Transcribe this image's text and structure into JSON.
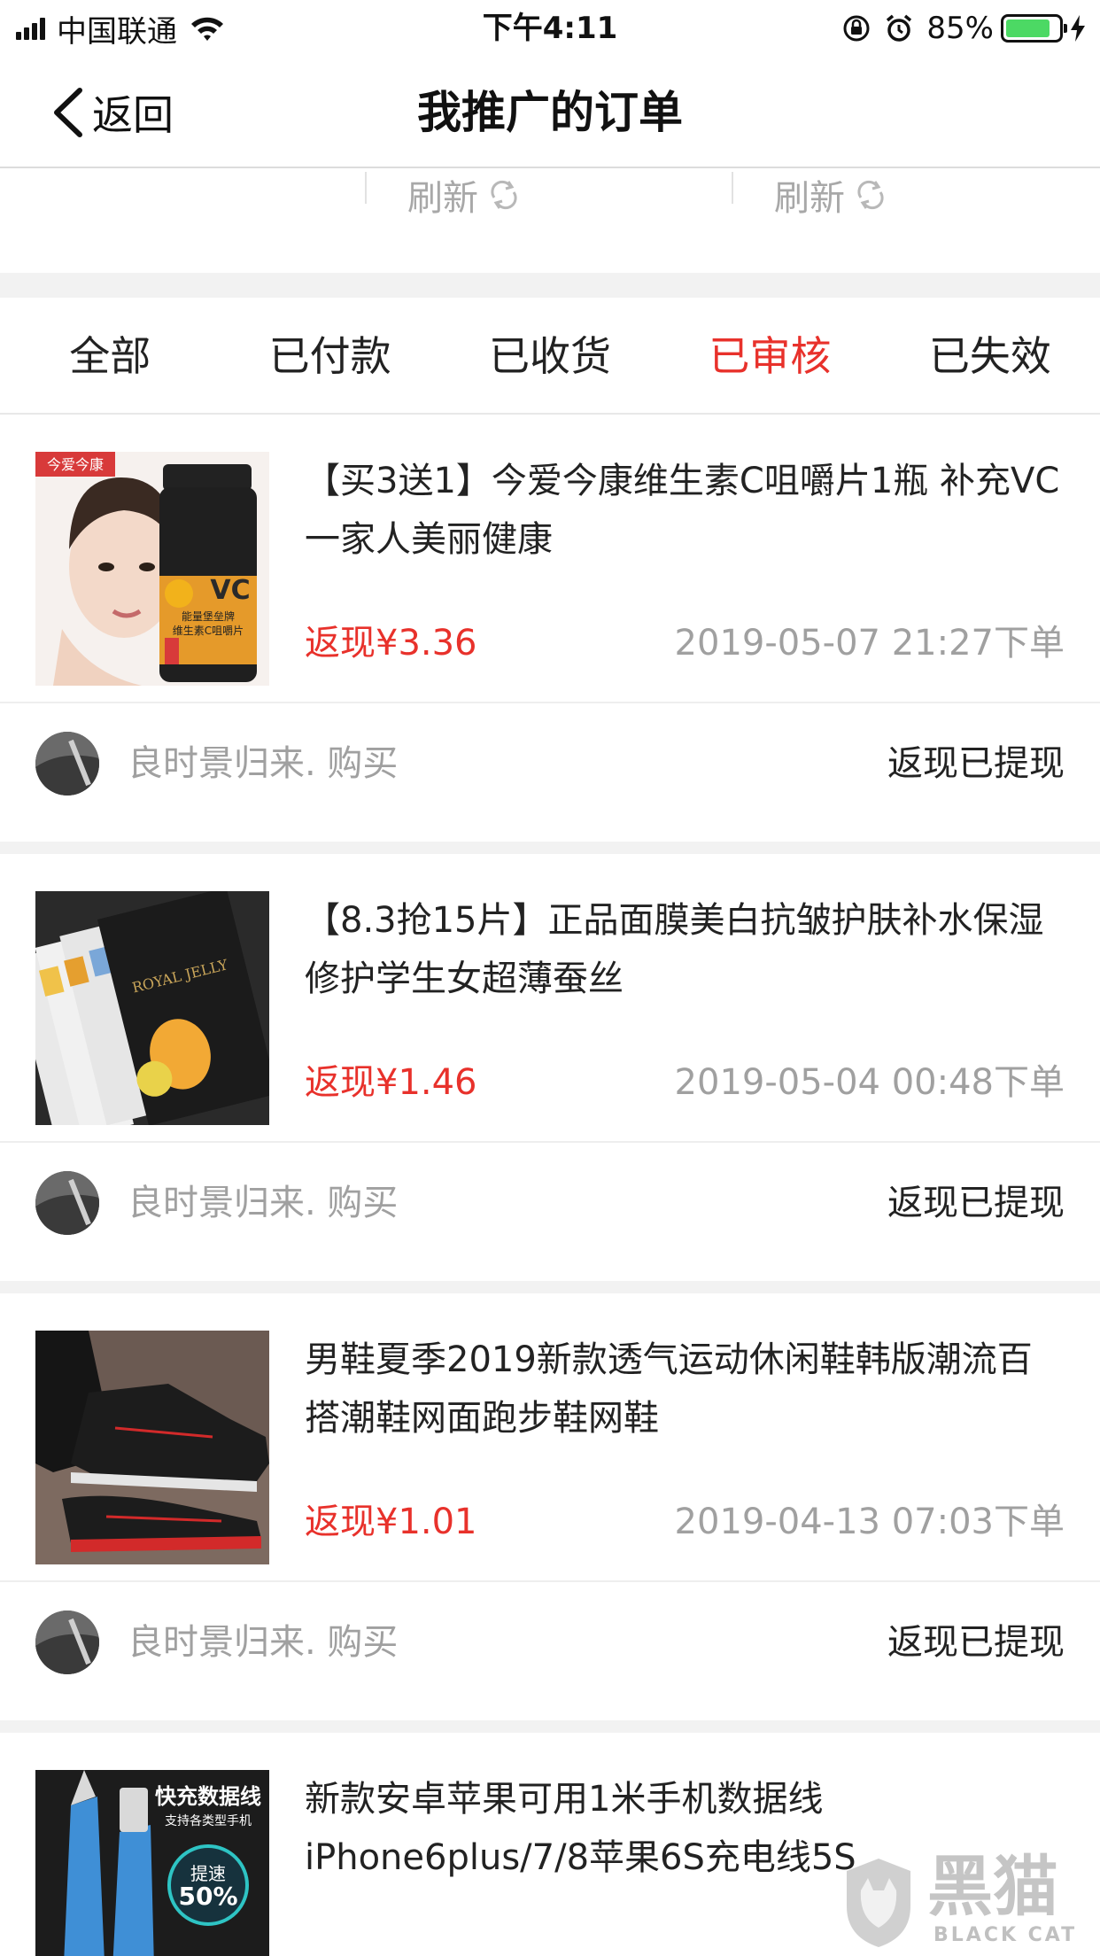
{
  "status_bar": {
    "carrier": "中国联通",
    "time": "下午4:11",
    "battery": "85%",
    "battery_level": 0.85
  },
  "nav": {
    "back_label": "返回",
    "title": "我推广的订单"
  },
  "refresh": {
    "labels": [
      "刷新",
      "刷新"
    ]
  },
  "tabs": [
    {
      "label": "全部",
      "active": false
    },
    {
      "label": "已付款",
      "active": false
    },
    {
      "label": "已收货",
      "active": false
    },
    {
      "label": "已审核",
      "active": true
    },
    {
      "label": "已失效",
      "active": false
    }
  ],
  "orders": [
    {
      "title": "【买3送1】今爱今康维生素C咀嚼片1瓶 补充VC 一家人美丽健康",
      "cashback": "返现¥3.36",
      "time": "2019-05-07 21:27下单",
      "buyer": "良时景归来. 购买",
      "status": "返现已提现",
      "thumb_text": {
        "brand": "今爱今康",
        "vc": "VC",
        "line1": "能量堡垒牌",
        "line2": "维生素C咀嚼片"
      }
    },
    {
      "title": "【8.3抢15片】正品面膜美白抗皱护肤补水保湿修护学生女超薄蚕丝",
      "cashback": "返现¥1.46",
      "time": "2019-05-04 00:48下单",
      "buyer": "良时景归来. 购买",
      "status": "返现已提现",
      "thumb_text": {
        "label": "ROYAL JELLY"
      }
    },
    {
      "title": "男鞋夏季2019新款透气运动休闲鞋韩版潮流百搭潮鞋网面跑步鞋网鞋",
      "cashback": "返现¥1.01",
      "time": "2019-04-13 07:03下单",
      "buyer": "良时景归来. 购买",
      "status": "返现已提现"
    },
    {
      "title": "新款安卓苹果可用1米手机数据线iPhone6plus/7/8苹果6S充电线5S",
      "thumb_text": {
        "line1": "快充数据线",
        "line2": "支持各类型手机",
        "badge1": "提速",
        "badge2": "50%"
      }
    }
  ],
  "watermark": {
    "name": "黑猫",
    "sub": "BLACK CAT"
  }
}
